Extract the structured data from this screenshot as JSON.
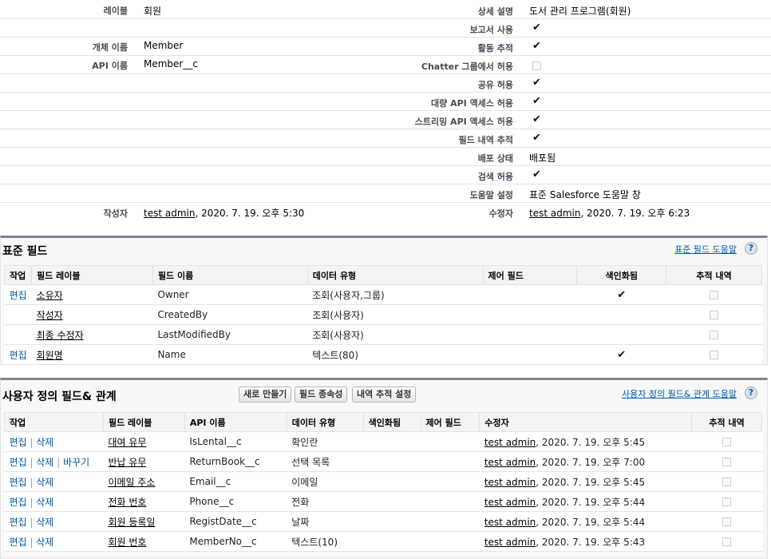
{
  "detail": {
    "left": [
      {
        "label": "레이블",
        "value": "회원"
      },
      {
        "label": "개체 이름",
        "value": "Member"
      },
      {
        "label": "API 이름",
        "value": "Member__c"
      }
    ],
    "right": [
      {
        "label": "상세 설명",
        "value": "도서 관리 프로그램(회원)",
        "type": "text"
      },
      {
        "label": "보고서 사용",
        "value": "✔",
        "type": "check"
      },
      {
        "label": "활동 추적",
        "value": "✔",
        "type": "check"
      },
      {
        "label": "Chatter 그룹에서 허용",
        "value": "",
        "type": "empty"
      },
      {
        "label": "공유 허용",
        "value": "✔",
        "type": "check"
      },
      {
        "label": "대량 API 액세스 허용",
        "value": "✔",
        "type": "check"
      },
      {
        "label": "스트리밍 API 액세스 허용",
        "value": "✔",
        "type": "check"
      },
      {
        "label": "필드 내역 추적",
        "value": "✔",
        "type": "check"
      },
      {
        "label": "배포 상태",
        "value": "배포됨",
        "type": "text"
      },
      {
        "label": "검색 허용",
        "value": "✔",
        "type": "check"
      },
      {
        "label": "도움말 설정",
        "value": "표준 Salesforce 도움말 창",
        "type": "text"
      }
    ],
    "created_label": "작성자",
    "created_user": "test admin",
    "created_date": ", 2020. 7. 19. 오후 5:30",
    "modified_label": "수정자",
    "modified_user": "test admin",
    "modified_date": ", 2020. 7. 19. 오후 6:23"
  },
  "standard": {
    "title": "표준 필드",
    "help_link": "표준 필드 도움말",
    "help_icon": "?",
    "columns": [
      "작업",
      "필드 레이블",
      "필드 이름",
      "데이터 유형",
      "제어 필드",
      "색인화됨",
      "추적 내역"
    ],
    "rows": [
      {
        "action": "편집",
        "label": "소유자",
        "name": "Owner",
        "type": "조회(사용자,그룹)",
        "control": "",
        "indexed": "✔"
      },
      {
        "action": "",
        "label": "작성자",
        "name": "CreatedBy",
        "type": "조회(사용자)",
        "control": "",
        "indexed": ""
      },
      {
        "action": "",
        "label": "최종 수정자",
        "name": "LastModifiedBy",
        "type": "조회(사용자)",
        "control": "",
        "indexed": ""
      },
      {
        "action": "편집",
        "label": "회원명",
        "name": "Name",
        "type": "텍스트(80)",
        "control": "",
        "indexed": "✔"
      }
    ]
  },
  "custom": {
    "title": "사용자 정의 필드& 관계",
    "buttons": [
      "새로 만들기",
      "필드 종속성",
      "내역 추적 설정"
    ],
    "help_link": "사용자 정의 필드& 관계 도움말",
    "help_icon": "?",
    "columns": [
      "작업",
      "필드 레이블",
      "API 이름",
      "데이터 유형",
      "색인화됨",
      "제어 필드",
      "수정자",
      "추적 내역"
    ],
    "action_edit": "편집",
    "action_delete": "삭제",
    "action_replace": "바꾸기",
    "rows": [
      {
        "label": "대여 유무",
        "api": "IsLental__c",
        "type": "확인란",
        "user": "test admin",
        "date": ", 2020. 7. 19. 오후 5:45",
        "replace": false
      },
      {
        "label": "반납 유무",
        "api": "ReturnBook__c",
        "type": "선택 목록",
        "user": "test admin",
        "date": ", 2020. 7. 19. 오후 7:00",
        "replace": true
      },
      {
        "label": "이메일 주소",
        "api": "Email__c",
        "type": "이메일",
        "user": "test admin",
        "date": ", 2020. 7. 19. 오후 5:45",
        "replace": false
      },
      {
        "label": "전화 번호",
        "api": "Phone__c",
        "type": "전화",
        "user": "test admin",
        "date": ", 2020. 7. 19. 오후 5:44",
        "replace": false
      },
      {
        "label": "회원 등록일",
        "api": "RegistDate__c",
        "type": "날짜",
        "user": "test admin",
        "date": ", 2020. 7. 19. 오후 5:44",
        "replace": false
      },
      {
        "label": "회원 번호",
        "api": "MemberNo__c",
        "type": "텍스트(10)",
        "user": "test admin",
        "date": ", 2020. 7. 19. 오후 5:43",
        "replace": false
      }
    ]
  },
  "colors": {
    "link": "#015ba7",
    "section_border": "#7f8791",
    "header_bg": "#f2f3f3"
  }
}
